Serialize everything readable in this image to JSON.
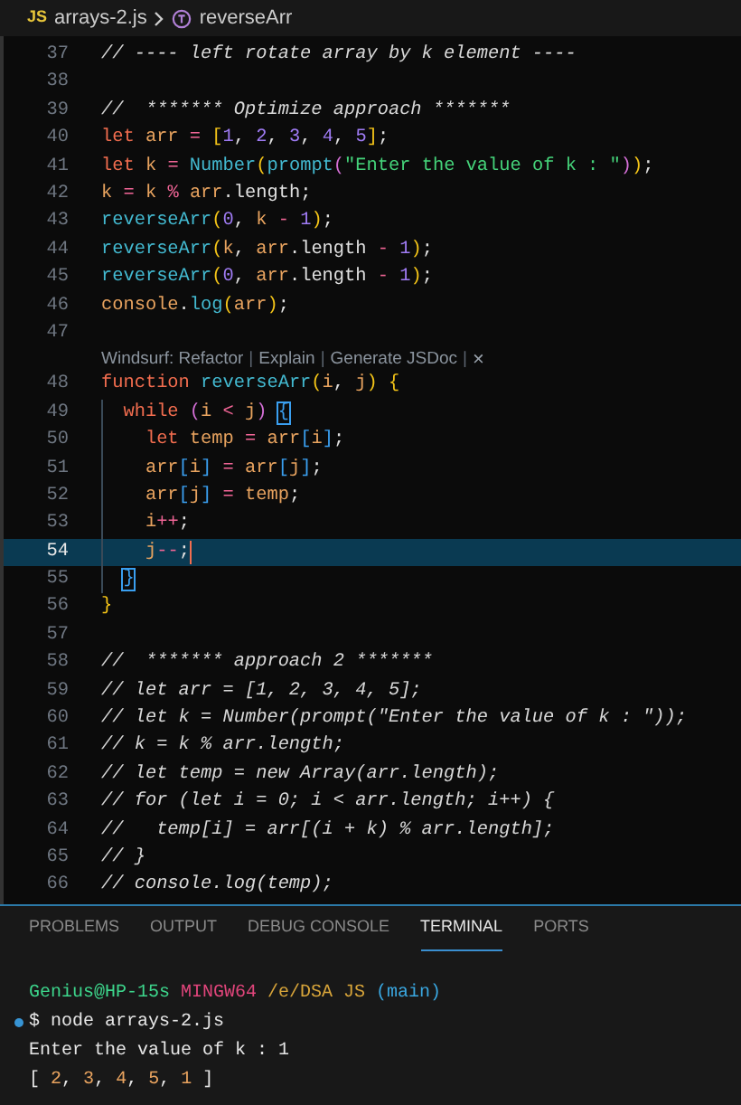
{
  "breadcrumb": {
    "file_badge": "JS",
    "file": "arrays-2.js",
    "symbol": "reverseArr"
  },
  "editor": {
    "lines": [
      {
        "number": "37",
        "current": false,
        "tokens": [
          {
            "text": "// ---- left rotate array by k element ----",
            "kind": "cm"
          }
        ]
      },
      {
        "number": "38",
        "current": false
      },
      {
        "number": "39",
        "current": false,
        "tokens": [
          {
            "text": "//  ******* Optimize approach *******",
            "kind": "cm"
          }
        ]
      },
      {
        "number": "40",
        "current": false,
        "tokens": [
          {
            "text": "let",
            "kind": "kw"
          },
          {
            "text": " arr ",
            "kind": "var"
          },
          {
            "text": "=",
            "kind": "op"
          },
          {
            "text": " [",
            "kind": "b1"
          },
          {
            "text": "1",
            "kind": "num"
          },
          {
            "text": ", ",
            "kind": "pun"
          },
          {
            "text": "2",
            "kind": "num"
          },
          {
            "text": ", ",
            "kind": "pun"
          },
          {
            "text": "3",
            "kind": "num"
          },
          {
            "text": ", ",
            "kind": "pun"
          },
          {
            "text": "4",
            "kind": "num"
          },
          {
            "text": ", ",
            "kind": "pun"
          },
          {
            "text": "5",
            "kind": "num"
          },
          {
            "text": "]",
            "kind": "b1"
          },
          {
            "text": ";",
            "kind": "pun"
          }
        ]
      },
      {
        "number": "41",
        "current": false,
        "tokens": [
          {
            "text": "let",
            "kind": "kw"
          },
          {
            "text": " k ",
            "kind": "var"
          },
          {
            "text": "=",
            "kind": "op"
          },
          {
            "text": " Number",
            "kind": "fn"
          },
          {
            "text": "(",
            "kind": "b1"
          },
          {
            "text": "prompt",
            "kind": "fn"
          },
          {
            "text": "(",
            "kind": "b2"
          },
          {
            "text": "\"Enter the value of k : \"",
            "kind": "str"
          },
          {
            "text": ")",
            "kind": "b2"
          },
          {
            "text": ")",
            "kind": "b1"
          },
          {
            "text": ";",
            "kind": "pun"
          }
        ]
      },
      {
        "number": "42",
        "current": false,
        "tokens": [
          {
            "text": "k ",
            "kind": "var"
          },
          {
            "text": "=",
            "kind": "op"
          },
          {
            "text": " k ",
            "kind": "var"
          },
          {
            "text": "%",
            "kind": "op"
          },
          {
            "text": " arr",
            "kind": "var"
          },
          {
            "text": ".length;",
            "kind": "pun"
          }
        ]
      },
      {
        "number": "43",
        "current": false,
        "tokens": [
          {
            "text": "reverseArr",
            "kind": "fn"
          },
          {
            "text": "(",
            "kind": "b1"
          },
          {
            "text": "0",
            "kind": "num"
          },
          {
            "text": ", ",
            "kind": "pun"
          },
          {
            "text": "k ",
            "kind": "var"
          },
          {
            "text": "-",
            "kind": "op"
          },
          {
            "text": " 1",
            "kind": "num"
          },
          {
            "text": ")",
            "kind": "b1"
          },
          {
            "text": ";",
            "kind": "pun"
          }
        ]
      },
      {
        "number": "44",
        "current": false,
        "tokens": [
          {
            "text": "reverseArr",
            "kind": "fn"
          },
          {
            "text": "(",
            "kind": "b1"
          },
          {
            "text": "k",
            "kind": "var"
          },
          {
            "text": ", ",
            "kind": "pun"
          },
          {
            "text": "arr",
            "kind": "var"
          },
          {
            "text": ".length ",
            "kind": "pun"
          },
          {
            "text": "-",
            "kind": "op"
          },
          {
            "text": " 1",
            "kind": "num"
          },
          {
            "text": ")",
            "kind": "b1"
          },
          {
            "text": ";",
            "kind": "pun"
          }
        ]
      },
      {
        "number": "45",
        "current": false,
        "tokens": [
          {
            "text": "reverseArr",
            "kind": "fn"
          },
          {
            "text": "(",
            "kind": "b1"
          },
          {
            "text": "0",
            "kind": "num"
          },
          {
            "text": ", ",
            "kind": "pun"
          },
          {
            "text": "arr",
            "kind": "var"
          },
          {
            "text": ".length ",
            "kind": "pun"
          },
          {
            "text": "-",
            "kind": "op"
          },
          {
            "text": " 1",
            "kind": "num"
          },
          {
            "text": ")",
            "kind": "b1"
          },
          {
            "text": ";",
            "kind": "pun"
          }
        ]
      },
      {
        "number": "46",
        "current": false,
        "tokens": [
          {
            "text": "console",
            "kind": "var"
          },
          {
            "text": ".",
            "kind": "pun"
          },
          {
            "text": "log",
            "kind": "fn"
          },
          {
            "text": "(",
            "kind": "b1"
          },
          {
            "text": "arr",
            "kind": "var"
          },
          {
            "text": ")",
            "kind": "b1"
          },
          {
            "text": ";",
            "kind": "pun"
          }
        ]
      },
      {
        "number": "47",
        "current": false,
        "codelens": [
          {
            "kind": "link",
            "text": "Windsurf: Refactor"
          },
          {
            "kind": "sep",
            "text": "|"
          },
          {
            "kind": "link",
            "text": "Explain"
          },
          {
            "kind": "sep",
            "text": "|"
          },
          {
            "kind": "link",
            "text": "Generate JSDoc"
          },
          {
            "kind": "sep",
            "text": "|"
          },
          {
            "kind": "close",
            "text": "×"
          }
        ]
      },
      {
        "number": "48",
        "current": false,
        "tokens": [
          {
            "text": "function",
            "kind": "kw"
          },
          {
            "text": " reverseArr",
            "kind": "fn"
          },
          {
            "text": "(",
            "kind": "b1"
          },
          {
            "text": "i",
            "kind": "var"
          },
          {
            "text": ", ",
            "kind": "pun"
          },
          {
            "text": "j",
            "kind": "var"
          },
          {
            "text": ")",
            "kind": "b1"
          },
          {
            "text": " {",
            "kind": "b1"
          }
        ]
      },
      {
        "number": "49",
        "current": false,
        "tokens": [
          {
            "text": "  while",
            "kind": "kw"
          },
          {
            "text": " (",
            "kind": "b2"
          },
          {
            "text": "i ",
            "kind": "var"
          },
          {
            "text": "<",
            "kind": "op"
          },
          {
            "text": " j",
            "kind": "var"
          },
          {
            "text": ") ",
            "kind": "b2"
          },
          {
            "text": "{",
            "kind": "b2m"
          }
        ]
      },
      {
        "number": "50",
        "current": false,
        "tokens": [
          {
            "text": "    let",
            "kind": "kw"
          },
          {
            "text": " temp ",
            "kind": "var"
          },
          {
            "text": "=",
            "kind": "op"
          },
          {
            "text": " arr",
            "kind": "var"
          },
          {
            "text": "[",
            "kind": "b3"
          },
          {
            "text": "i",
            "kind": "var"
          },
          {
            "text": "]",
            "kind": "b3"
          },
          {
            "text": ";",
            "kind": "pun"
          }
        ]
      },
      {
        "number": "51",
        "current": false,
        "tokens": [
          {
            "text": "    arr",
            "kind": "var"
          },
          {
            "text": "[",
            "kind": "b3"
          },
          {
            "text": "i",
            "kind": "var"
          },
          {
            "text": "]",
            "kind": "b3"
          },
          {
            "text": " =",
            "kind": "op"
          },
          {
            "text": " arr",
            "kind": "var"
          },
          {
            "text": "[",
            "kind": "b3"
          },
          {
            "text": "j",
            "kind": "var"
          },
          {
            "text": "]",
            "kind": "b3"
          },
          {
            "text": ";",
            "kind": "pun"
          }
        ]
      },
      {
        "number": "52",
        "current": false,
        "tokens": [
          {
            "text": "    arr",
            "kind": "var"
          },
          {
            "text": "[",
            "kind": "b3"
          },
          {
            "text": "j",
            "kind": "var"
          },
          {
            "text": "]",
            "kind": "b3"
          },
          {
            "text": " =",
            "kind": "op"
          },
          {
            "text": " temp",
            "kind": "var"
          },
          {
            "text": ";",
            "kind": "pun"
          }
        ]
      },
      {
        "number": "53",
        "current": false,
        "tokens": [
          {
            "text": "    i",
            "kind": "var"
          },
          {
            "text": "++",
            "kind": "op"
          },
          {
            "text": ";",
            "kind": "pun"
          }
        ]
      },
      {
        "number": "54",
        "current": true,
        "tokens": [
          {
            "text": "    j",
            "kind": "var"
          },
          {
            "text": "--",
            "kind": "op"
          },
          {
            "text": ";",
            "kind": "pun"
          }
        ]
      },
      {
        "number": "55",
        "current": false,
        "tokens": [
          {
            "text": "  }",
            "kind": "b2m"
          }
        ]
      },
      {
        "number": "56",
        "current": false,
        "tokens": [
          {
            "text": "}",
            "kind": "b1"
          }
        ]
      },
      {
        "number": "57",
        "current": false
      },
      {
        "number": "58",
        "current": false,
        "tokens": [
          {
            "text": "//  ******* approach 2 *******",
            "kind": "cm"
          }
        ]
      },
      {
        "number": "59",
        "current": false,
        "tokens": [
          {
            "text": "// let arr = [1, 2, 3, 4, 5];",
            "kind": "cm"
          }
        ]
      },
      {
        "number": "60",
        "current": false,
        "tokens": [
          {
            "text": "// let k = Number(prompt(\"Enter the value of k : \"));",
            "kind": "cm"
          }
        ]
      },
      {
        "number": "61",
        "current": false,
        "tokens": [
          {
            "text": "// k = k % arr.length;",
            "kind": "cm"
          }
        ]
      },
      {
        "number": "62",
        "current": false,
        "tokens": [
          {
            "text": "// let temp = new Array(arr.length);",
            "kind": "cm"
          }
        ]
      },
      {
        "number": "63",
        "current": false,
        "tokens": [
          {
            "text": "// for (let i = 0; i < arr.length; i++) {",
            "kind": "cm"
          }
        ]
      },
      {
        "number": "64",
        "current": false,
        "tokens": [
          {
            "text": "//   temp[i] = arr[(i + k) % arr.length];",
            "kind": "cm"
          }
        ]
      },
      {
        "number": "65",
        "current": false,
        "tokens": [
          {
            "text": "// }",
            "kind": "cm"
          }
        ]
      },
      {
        "number": "66",
        "current": false,
        "tokens": [
          {
            "text": "// console.log(temp);",
            "kind": "cm"
          }
        ]
      }
    ]
  },
  "panel": {
    "tabs": [
      {
        "label": "PROBLEMS",
        "selected": false
      },
      {
        "label": "OUTPUT",
        "selected": false
      },
      {
        "label": "DEBUG CONSOLE",
        "selected": false
      },
      {
        "label": "TERMINAL",
        "selected": true
      },
      {
        "label": "PORTS",
        "selected": false
      }
    ],
    "terminal": [
      {
        "kind": "prompt",
        "tokens": [
          {
            "text": "Genius@HP-15s",
            "kind": "user"
          },
          {
            "text": " MINGW64",
            "kind": "host"
          },
          {
            "text": " /e/DSA JS",
            "kind": "path"
          },
          {
            "text": " (main)",
            "kind": "branch"
          }
        ]
      },
      {
        "kind": "command",
        "tokens": [
          {
            "text": "$ node arrays-2.js",
            "kind": "plain"
          }
        ]
      },
      {
        "kind": "output",
        "tokens": [
          {
            "text": "Enter the value of k : 1",
            "kind": "plain"
          }
        ]
      },
      {
        "kind": "output",
        "tokens": [
          {
            "text": "[ ",
            "kind": "plain"
          },
          {
            "text": "2",
            "kind": "num"
          },
          {
            "text": ", ",
            "kind": "plain"
          },
          {
            "text": "3",
            "kind": "num"
          },
          {
            "text": ", ",
            "kind": "plain"
          },
          {
            "text": "4",
            "kind": "num"
          },
          {
            "text": ", ",
            "kind": "plain"
          },
          {
            "text": "5",
            "kind": "num"
          },
          {
            "text": ", ",
            "kind": "plain"
          },
          {
            "text": "1",
            "kind": "num"
          },
          {
            "text": " ]",
            "kind": "plain"
          }
        ]
      }
    ]
  }
}
